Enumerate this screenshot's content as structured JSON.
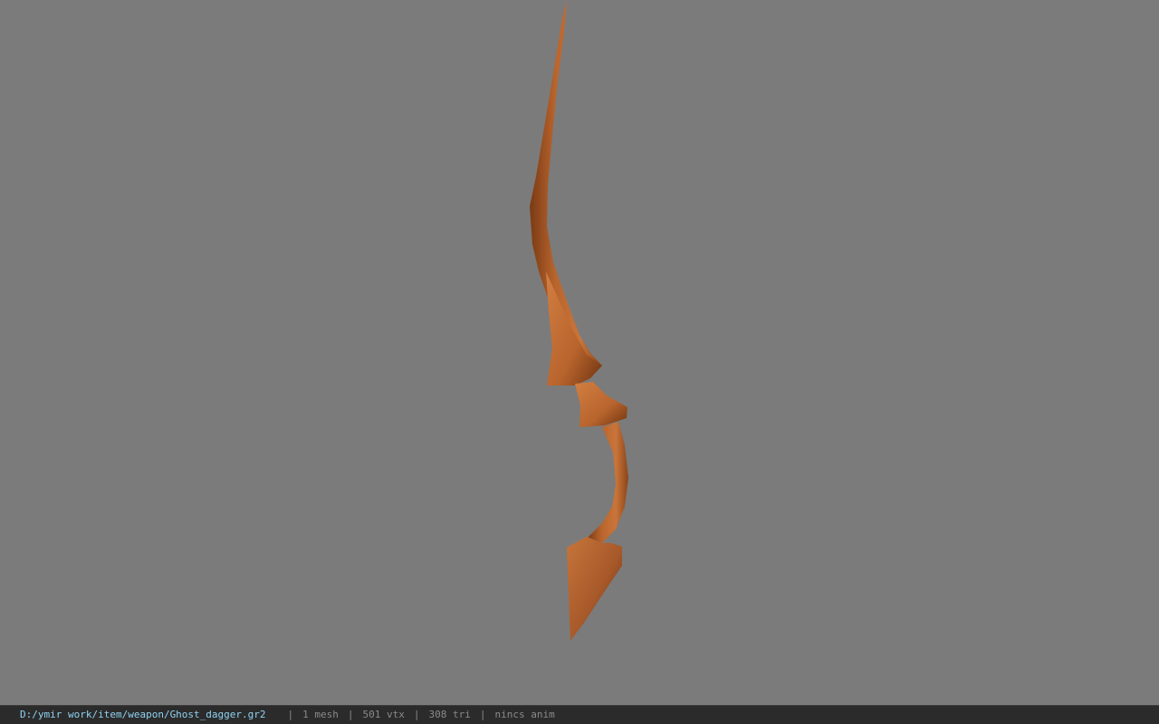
{
  "viewport": {
    "background": "#7b7b7b",
    "model_color": "#b8642d"
  },
  "status": {
    "path": "D:/ymir work/item/weapon/Ghost_dagger.gr2",
    "mesh": "1 mesh",
    "vertices": "501 vtx",
    "triangles": "308 tri",
    "anim": "nincs anim",
    "separator": "|"
  }
}
